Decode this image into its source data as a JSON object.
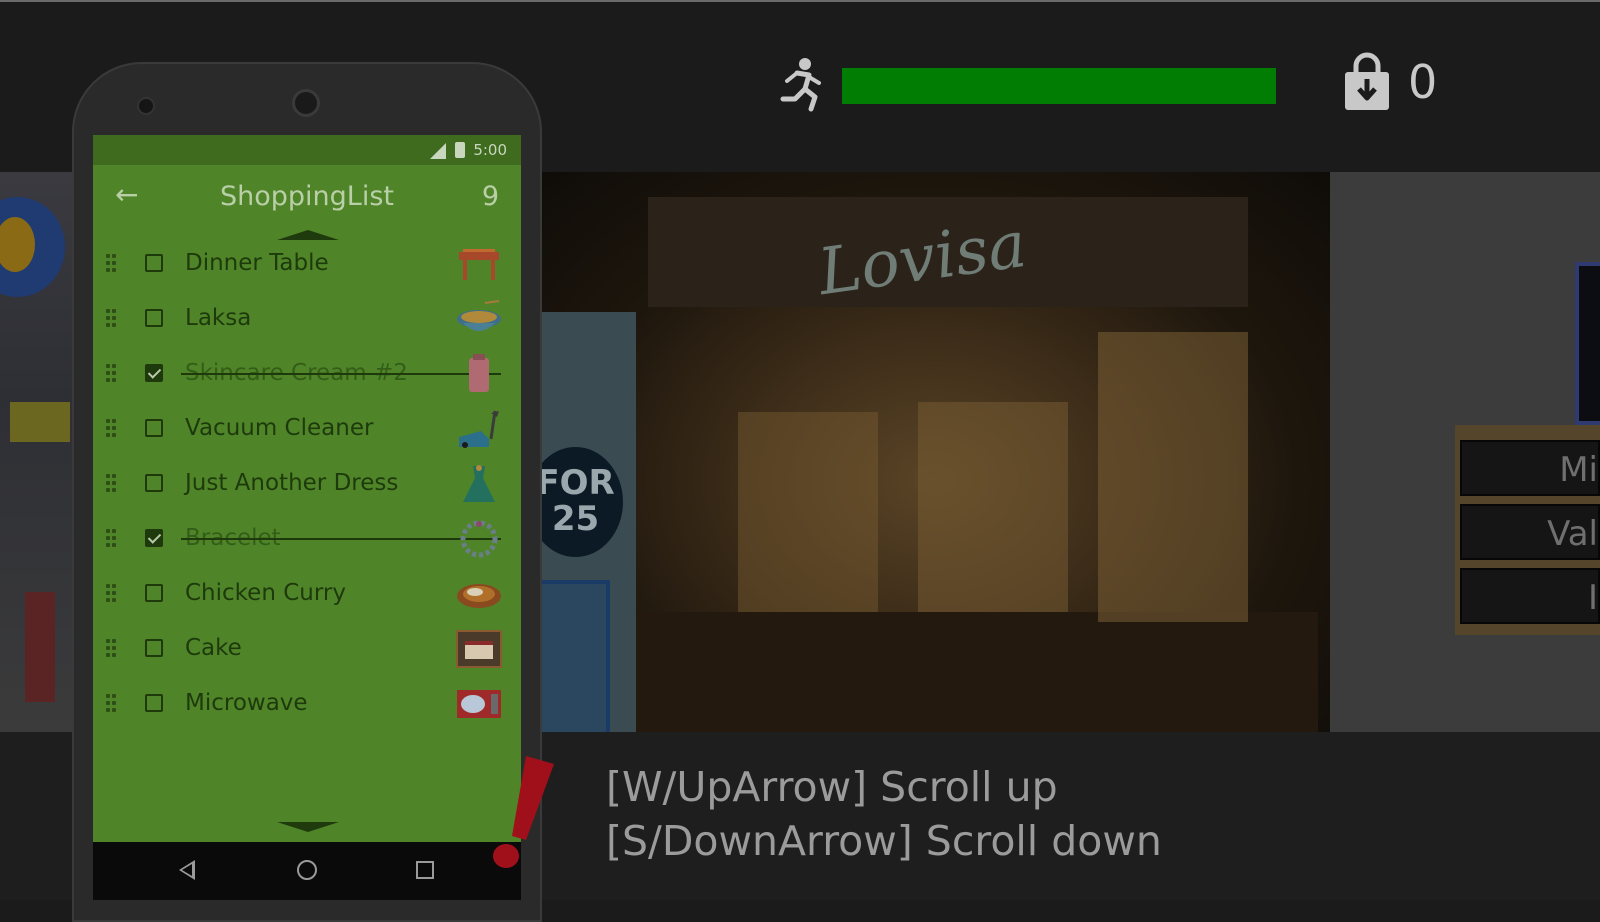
{
  "hud": {
    "run_icon": "running-man-icon",
    "stamina_fraction": 1.0,
    "stamina_color": "#017d03",
    "bag_icon": "shopping-bag-download-icon",
    "bag_count": "0"
  },
  "phone": {
    "status_time": "5:00",
    "app_title": "ShoppingList",
    "item_count": "9",
    "back_icon": "back-arrow-icon",
    "items": [
      {
        "label": "Dinner Table",
        "checked": false,
        "icon": "dinner-table-icon"
      },
      {
        "label": "Laksa",
        "checked": false,
        "icon": "laksa-bowl-icon"
      },
      {
        "label": "Skincare Cream #2",
        "checked": true,
        "icon": "skincare-cream-icon"
      },
      {
        "label": "Vacuum Cleaner",
        "checked": false,
        "icon": "vacuum-cleaner-icon"
      },
      {
        "label": "Just Another Dress",
        "checked": false,
        "icon": "dress-icon"
      },
      {
        "label": "Bracelet",
        "checked": true,
        "icon": "bracelet-icon"
      },
      {
        "label": "Chicken Curry",
        "checked": false,
        "icon": "chicken-curry-icon"
      },
      {
        "label": "Cake",
        "checked": false,
        "icon": "cake-icon"
      },
      {
        "label": "Microwave",
        "checked": false,
        "icon": "microwave-icon"
      }
    ]
  },
  "scene": {
    "store_sign": "Lovisa",
    "promo_text": "FOR 25",
    "right_buttons": [
      "Mi",
      "Val",
      "I"
    ]
  },
  "hints": {
    "line1": "[W/UpArrow] Scroll up",
    "line2": "[S/DownArrow] Scroll down"
  },
  "colors": {
    "screen_green": "#4f8528",
    "alert_red": "#a0101a"
  }
}
